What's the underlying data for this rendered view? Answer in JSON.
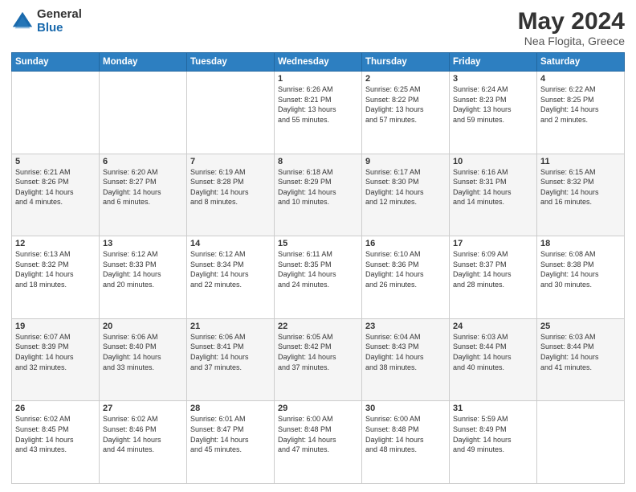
{
  "logo": {
    "general": "General",
    "blue": "Blue"
  },
  "title": "May 2024",
  "subtitle": "Nea Flogita, Greece",
  "days_header": [
    "Sunday",
    "Monday",
    "Tuesday",
    "Wednesday",
    "Thursday",
    "Friday",
    "Saturday"
  ],
  "weeks": [
    [
      {
        "day": "",
        "info": ""
      },
      {
        "day": "",
        "info": ""
      },
      {
        "day": "",
        "info": ""
      },
      {
        "day": "1",
        "info": "Sunrise: 6:26 AM\nSunset: 8:21 PM\nDaylight: 13 hours\nand 55 minutes."
      },
      {
        "day": "2",
        "info": "Sunrise: 6:25 AM\nSunset: 8:22 PM\nDaylight: 13 hours\nand 57 minutes."
      },
      {
        "day": "3",
        "info": "Sunrise: 6:24 AM\nSunset: 8:23 PM\nDaylight: 13 hours\nand 59 minutes."
      },
      {
        "day": "4",
        "info": "Sunrise: 6:22 AM\nSunset: 8:25 PM\nDaylight: 14 hours\nand 2 minutes."
      }
    ],
    [
      {
        "day": "5",
        "info": "Sunrise: 6:21 AM\nSunset: 8:26 PM\nDaylight: 14 hours\nand 4 minutes."
      },
      {
        "day": "6",
        "info": "Sunrise: 6:20 AM\nSunset: 8:27 PM\nDaylight: 14 hours\nand 6 minutes."
      },
      {
        "day": "7",
        "info": "Sunrise: 6:19 AM\nSunset: 8:28 PM\nDaylight: 14 hours\nand 8 minutes."
      },
      {
        "day": "8",
        "info": "Sunrise: 6:18 AM\nSunset: 8:29 PM\nDaylight: 14 hours\nand 10 minutes."
      },
      {
        "day": "9",
        "info": "Sunrise: 6:17 AM\nSunset: 8:30 PM\nDaylight: 14 hours\nand 12 minutes."
      },
      {
        "day": "10",
        "info": "Sunrise: 6:16 AM\nSunset: 8:31 PM\nDaylight: 14 hours\nand 14 minutes."
      },
      {
        "day": "11",
        "info": "Sunrise: 6:15 AM\nSunset: 8:32 PM\nDaylight: 14 hours\nand 16 minutes."
      }
    ],
    [
      {
        "day": "12",
        "info": "Sunrise: 6:13 AM\nSunset: 8:32 PM\nDaylight: 14 hours\nand 18 minutes."
      },
      {
        "day": "13",
        "info": "Sunrise: 6:12 AM\nSunset: 8:33 PM\nDaylight: 14 hours\nand 20 minutes."
      },
      {
        "day": "14",
        "info": "Sunrise: 6:12 AM\nSunset: 8:34 PM\nDaylight: 14 hours\nand 22 minutes."
      },
      {
        "day": "15",
        "info": "Sunrise: 6:11 AM\nSunset: 8:35 PM\nDaylight: 14 hours\nand 24 minutes."
      },
      {
        "day": "16",
        "info": "Sunrise: 6:10 AM\nSunset: 8:36 PM\nDaylight: 14 hours\nand 26 minutes."
      },
      {
        "day": "17",
        "info": "Sunrise: 6:09 AM\nSunset: 8:37 PM\nDaylight: 14 hours\nand 28 minutes."
      },
      {
        "day": "18",
        "info": "Sunrise: 6:08 AM\nSunset: 8:38 PM\nDaylight: 14 hours\nand 30 minutes."
      }
    ],
    [
      {
        "day": "19",
        "info": "Sunrise: 6:07 AM\nSunset: 8:39 PM\nDaylight: 14 hours\nand 32 minutes."
      },
      {
        "day": "20",
        "info": "Sunrise: 6:06 AM\nSunset: 8:40 PM\nDaylight: 14 hours\nand 33 minutes."
      },
      {
        "day": "21",
        "info": "Sunrise: 6:06 AM\nSunset: 8:41 PM\nDaylight: 14 hours\nand 37 minutes."
      },
      {
        "day": "22",
        "info": "Sunrise: 6:05 AM\nSunset: 8:42 PM\nDaylight: 14 hours\nand 37 minutes."
      },
      {
        "day": "23",
        "info": "Sunrise: 6:04 AM\nSunset: 8:43 PM\nDaylight: 14 hours\nand 38 minutes."
      },
      {
        "day": "24",
        "info": "Sunrise: 6:03 AM\nSunset: 8:44 PM\nDaylight: 14 hours\nand 40 minutes."
      },
      {
        "day": "25",
        "info": "Sunrise: 6:03 AM\nSunset: 8:44 PM\nDaylight: 14 hours\nand 41 minutes."
      }
    ],
    [
      {
        "day": "26",
        "info": "Sunrise: 6:02 AM\nSunset: 8:45 PM\nDaylight: 14 hours\nand 43 minutes."
      },
      {
        "day": "27",
        "info": "Sunrise: 6:02 AM\nSunset: 8:46 PM\nDaylight: 14 hours\nand 44 minutes."
      },
      {
        "day": "28",
        "info": "Sunrise: 6:01 AM\nSunset: 8:47 PM\nDaylight: 14 hours\nand 45 minutes."
      },
      {
        "day": "29",
        "info": "Sunrise: 6:00 AM\nSunset: 8:48 PM\nDaylight: 14 hours\nand 47 minutes."
      },
      {
        "day": "30",
        "info": "Sunrise: 6:00 AM\nSunset: 8:48 PM\nDaylight: 14 hours\nand 48 minutes."
      },
      {
        "day": "31",
        "info": "Sunrise: 5:59 AM\nSunset: 8:49 PM\nDaylight: 14 hours\nand 49 minutes."
      },
      {
        "day": "",
        "info": ""
      }
    ]
  ]
}
